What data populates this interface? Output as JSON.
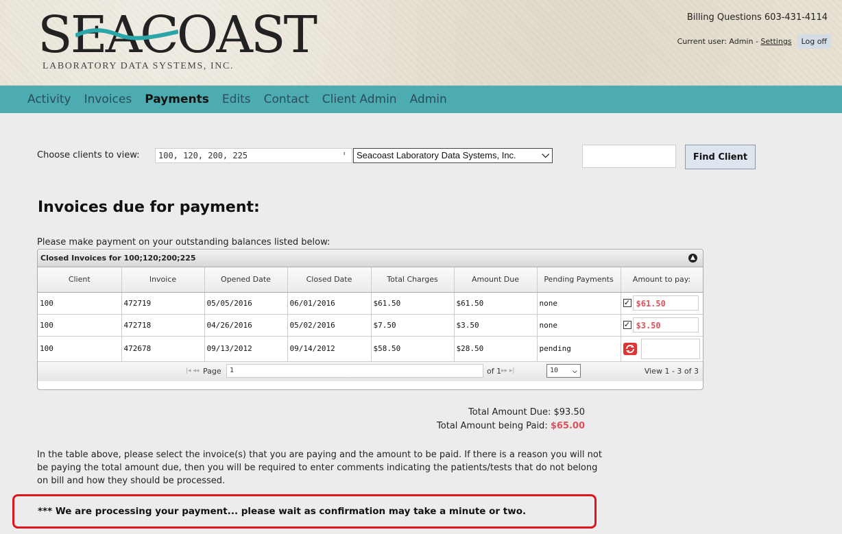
{
  "header": {
    "logo_text": "SEACOAST",
    "logo_sub": "LABORATORY DATA SYSTEMS, INC.",
    "billing": "Billing Questions 603-431-4114",
    "current_user_label": "Current user: Admin - ",
    "settings": "Settings",
    "logoff": "Log off"
  },
  "nav": {
    "items": [
      "Activity",
      "Invoices",
      "Payments",
      "Edits",
      "Contact",
      "Client Admin",
      "Admin"
    ],
    "active": "Payments"
  },
  "chooser": {
    "label": "Choose clients to view:",
    "clients_value": "100, 120, 200, 225",
    "client_select_value": "Seacoast Laboratory Data Systems, Inc.",
    "find_button": "Find Client"
  },
  "main": {
    "title": "Invoices due for payment:",
    "instruction": "Please make payment on your outstanding balances listed below:"
  },
  "grid": {
    "caption": "Closed Invoices for 100;120;200;225",
    "columns": [
      "Client",
      "Invoice",
      "Opened Date",
      "Closed Date",
      "Total Charges",
      "Amount Due",
      "Pending Payments",
      "Amount to pay:"
    ],
    "rows": [
      {
        "client": "100",
        "invoice": "472719",
        "opened": "05/05/2016",
        "closed": "06/01/2016",
        "total": "$61.50",
        "due": "$61.50",
        "pending": "none",
        "checked": true,
        "pay": "$61.50"
      },
      {
        "client": "100",
        "invoice": "472718",
        "opened": "04/26/2016",
        "closed": "05/02/2016",
        "total": "$7.50",
        "due": "$3.50",
        "pending": "none",
        "checked": true,
        "pay": "$3.50"
      },
      {
        "client": "100",
        "invoice": "472678",
        "opened": "09/13/2012",
        "closed": "09/14/2012",
        "total": "$58.50",
        "due": "$28.50",
        "pending": "pending",
        "checked": false,
        "pay": ""
      }
    ],
    "pager": {
      "page_label": "Page",
      "page_value": "1",
      "of_label": "of 1",
      "rows_per_page": "10",
      "view_label": "View 1 - 3 of 3"
    }
  },
  "totals": {
    "due_label": "Total Amount Due: $93.50",
    "paid_label": "Total Amount being Paid: ",
    "paid_value": "$65.00"
  },
  "notes": "In the table above, please select the invoice(s) that you are paying and the amount to be paid. If there is a reason you will not be paying the total amount due, then you will be required to enter comments indicating the patients/tests that do not belong on bill and how they should be processed.",
  "processing": "*** We are processing your payment... please wait as confirmation may take a minute or two.",
  "colors": {
    "nav_bg": "#4cacb2",
    "accent_red": "#e0505a",
    "highlight_border": "#e0141c"
  }
}
